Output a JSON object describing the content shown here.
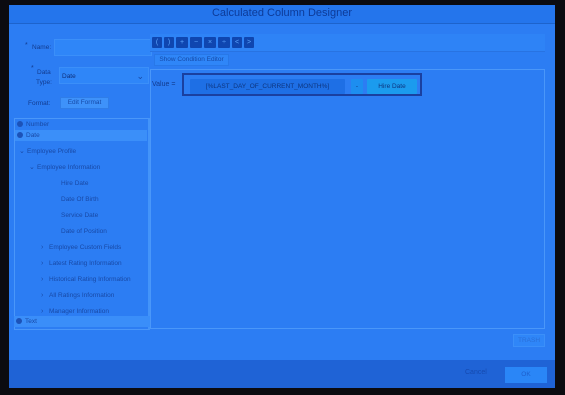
{
  "dialog": {
    "title": "Calculated Column Designer"
  },
  "form": {
    "name_label": "Name:",
    "name_value": "",
    "data_type_label_1": "Data",
    "data_type_label_2": "Type:",
    "data_type_value": "Date",
    "format_label": "Format:",
    "edit_format_button": "Edit Format",
    "required_marker": "*"
  },
  "tree": {
    "items": [
      {
        "label": "Number"
      },
      {
        "label": "Date"
      },
      {
        "label": "Employee Profile"
      },
      {
        "label": "Employee Information"
      },
      {
        "label": "Hire Date"
      },
      {
        "label": "Date Of Birth"
      },
      {
        "label": "Service Date"
      },
      {
        "label": "Date of Position"
      },
      {
        "label": "Employee Custom Fields"
      },
      {
        "label": "Latest Rating Information"
      },
      {
        "label": "Historical Rating Information"
      },
      {
        "label": "All Ratings Information"
      },
      {
        "label": "Manager Information"
      }
    ],
    "footer_item": "Text"
  },
  "toolbar": {
    "buttons": [
      "(",
      ")",
      "+",
      "−",
      "×",
      "÷",
      "<",
      ">"
    ],
    "show_condition_editor": "Show Condition Editor"
  },
  "expression": {
    "value_label": "Value =",
    "function_chip": "[%LAST_DAY_OF_CURRENT_MONTH%]",
    "operator_chip": "-",
    "field_chip": "Hire Date"
  },
  "actions": {
    "trash": "TRASH",
    "cancel": "Cancel",
    "ok": "OK"
  },
  "colors": {
    "overlay_blue": "#2c7df3",
    "background": "#0b0b10"
  }
}
